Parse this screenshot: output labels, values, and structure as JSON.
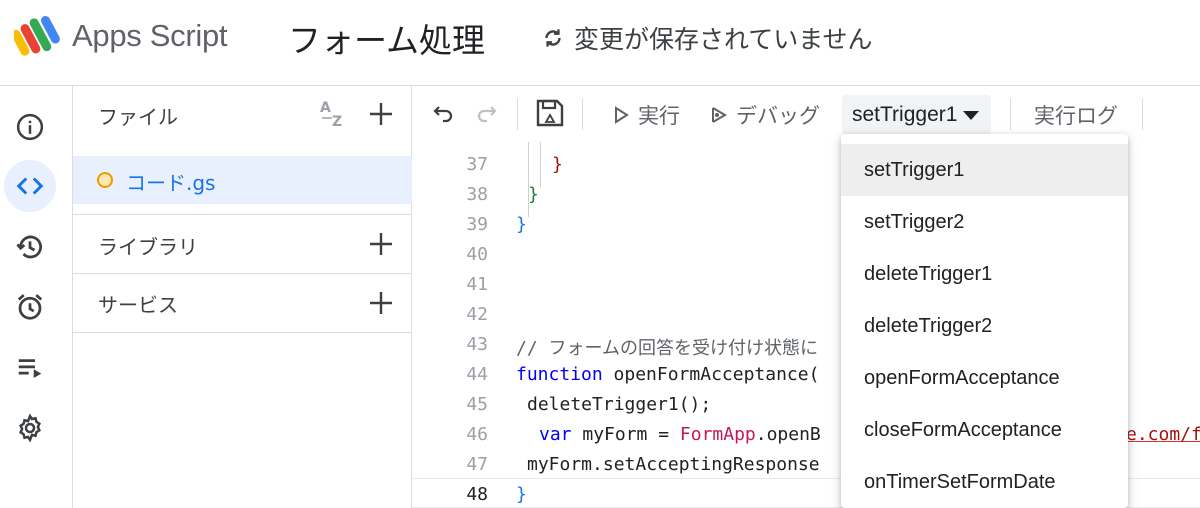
{
  "header": {
    "app_name": "Apps Script",
    "project_title": "フォーム処理",
    "save_status": "変更が保存されていません"
  },
  "rail": {
    "items": [
      "overview-icon",
      "editor-icon",
      "history-icon",
      "triggers-icon",
      "executions-icon",
      "settings-icon"
    ],
    "active": "editor-icon"
  },
  "panel": {
    "files_label": "ファイル",
    "file_name": "コード.gs",
    "libraries_label": "ライブラリ",
    "services_label": "サービス"
  },
  "toolbar": {
    "run_label": "実行",
    "debug_label": "デバッグ",
    "selected_function": "setTrigger1",
    "log_label": "実行ログ"
  },
  "code": {
    "line_numbers": [
      "37",
      "38",
      "39",
      "40",
      "41",
      "42",
      "43",
      "44",
      "45",
      "46",
      "47",
      "48"
    ],
    "line_37": "}",
    "line_38": "}",
    "line_39": "}",
    "line_43": "// フォームの回答を受け付け状態に",
    "line_44_kw": "function",
    "line_44_rest": " openFormAcceptance(",
    "line_45": "deleteTrigger1();",
    "line_46_kw": "var",
    "line_46_mid": " myForm = ",
    "line_46_cls": "FormApp",
    "line_46_rest": ".openB",
    "line_46_url": "e.com/f",
    "line_47": "myForm.setAcceptingResponse",
    "line_48": "}"
  },
  "dropdown": {
    "items": [
      "setTrigger1",
      "setTrigger2",
      "deleteTrigger1",
      "deleteTrigger2",
      "openFormAcceptance",
      "closeFormAcceptance",
      "onTimerSetFormDate"
    ],
    "selected_index": 0
  },
  "colors": {
    "accent": "#1a73e8",
    "active_bg": "#e8f0fe",
    "keyword": "#0000ff",
    "class": "#c2185b"
  }
}
